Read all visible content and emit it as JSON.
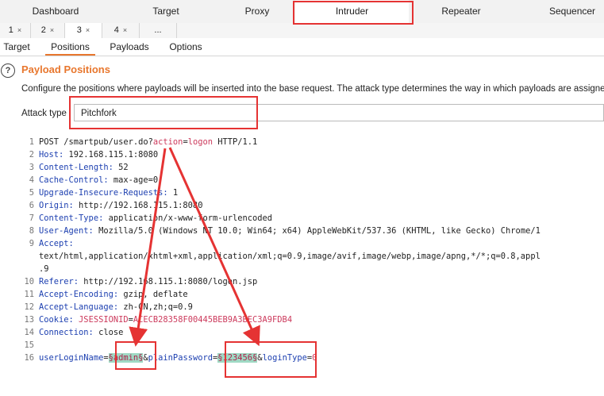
{
  "top_tabs": [
    {
      "label": "Dashboard"
    },
    {
      "label": "Target"
    },
    {
      "label": "Proxy"
    },
    {
      "label": "Intruder"
    },
    {
      "label": "Repeater"
    },
    {
      "label": "Sequencer"
    }
  ],
  "attack_tabs": [
    {
      "label": "1",
      "close": "×"
    },
    {
      "label": "2",
      "close": "×"
    },
    {
      "label": "3",
      "close": "×"
    },
    {
      "label": "4",
      "close": "×"
    },
    {
      "label": "...",
      "close": ""
    }
  ],
  "section_tabs": [
    {
      "label": "Target"
    },
    {
      "label": "Positions"
    },
    {
      "label": "Payloads"
    },
    {
      "label": "Options"
    }
  ],
  "panel": {
    "help_glyph": "?",
    "title": "Payload Positions",
    "description": "Configure the positions where payloads will be inserted into the base request. The attack type determines the way in which payloads are assigne",
    "attack_type_label": "Attack type",
    "attack_type_value": "Pitchfork"
  },
  "request": {
    "l1": {
      "n": "1",
      "a": "POST /smartpub/user.do?",
      "b": "action",
      "c": "=",
      "d": "logon",
      "e": " HTTP/1.1"
    },
    "l2": {
      "n": "2",
      "k": "Host:",
      "v": " 192.168.115.1:8080"
    },
    "l3": {
      "n": "3",
      "k": "Content-Length:",
      "v": " 52"
    },
    "l4": {
      "n": "4",
      "k": "Cache-Control:",
      "v": " max-age=0"
    },
    "l5": {
      "n": "5",
      "k": "Upgrade-Insecure-Requests:",
      "v": " 1"
    },
    "l6": {
      "n": "6",
      "k": "Origin:",
      "v": " http://192.168.115.1:8080"
    },
    "l7": {
      "n": "7",
      "k": "Content-Type:",
      "v": " application/x-www-form-urlencoded"
    },
    "l8": {
      "n": "8",
      "k": "User-Agent:",
      "v": " Mozilla/5.0 (Windows NT 10.0; Win64; x64) AppleWebKit/537.36 (KHTML, like Gecko) Chrome/1"
    },
    "l9": {
      "n": "9",
      "k": "Accept:",
      "w1": "text/html,application/xhtml+xml,application/xml;q=0.9,image/avif,image/webp,image/apng,*/*;q=0.8,appl",
      "w2": ".9"
    },
    "l10": {
      "n": "10",
      "k": "Referer:",
      "v": " http://192.168.115.1:8080/logon.jsp"
    },
    "l11": {
      "n": "11",
      "k": "Accept-Encoding:",
      "v": " gzip, deflate"
    },
    "l12": {
      "n": "12",
      "k": "Accept-Language:",
      "v": " zh-CN,zh;q=0.9"
    },
    "l13": {
      "n": "13",
      "k": "Cookie:",
      "c1": " JSESSIONID",
      "c2": "=",
      "c3": "ACECB28358F00445BEB9A3BEC3A9FDB4"
    },
    "l14": {
      "n": "14",
      "k": "Connection:",
      "v": " close"
    },
    "l15": {
      "n": "15"
    },
    "l16": {
      "n": "16",
      "p1": "userLoginName",
      "p2": "=",
      "p3": "§admin§",
      "p4": "&",
      "p5": "plainPassword",
      "p6": "=",
      "p7": "§123456§",
      "p8": "&",
      "p9": "loginType",
      "p10": "=",
      "p11": "0"
    }
  },
  "colors": {
    "accent": "#e8772e",
    "annotation": "#e53333",
    "payload_bg": "#9fd9c4",
    "header_key": "#1c3fb0"
  }
}
